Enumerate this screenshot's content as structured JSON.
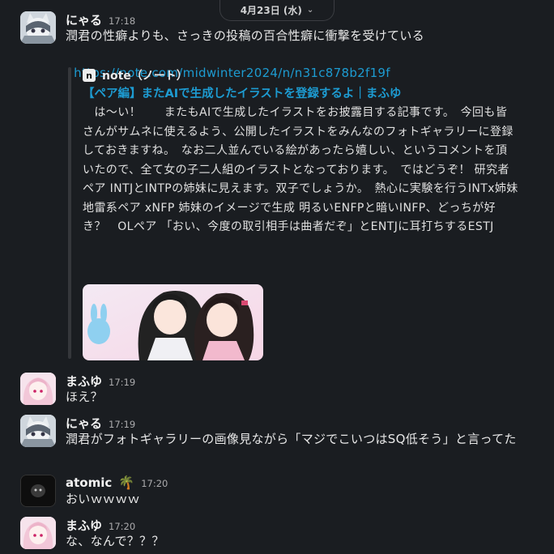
{
  "date_divider": {
    "label": "4月23日 (水)"
  },
  "messages": [
    {
      "author": "にゃる",
      "time": "17:18",
      "text": "潤君の性癖よりも、さっきの投稿の百合性癖に衝撃を受けている",
      "link": "https://note.com/midwinter2024/n/n31c878b2f19f",
      "unfurl": {
        "source_icon": "n",
        "source": "note（ノート）",
        "title": "【ペア編】またAIで生成したイラストを登録するよ｜まふゆ",
        "body": "　は〜い！　　またもAIで生成したイラストをお披露目する記事です。　今回も皆さんがサムネに使えるよう、公開したイラストをみんなのフォトギャラリーに登録しておきますね。　なお二人並んでいる絵があったら嬉しい、というコメントを頂いたので、全て女の子二人組のイラストとなっております。　ではどうぞ！ 研究者ペア INTJとINTPの姉妹に見えます。双子でしょうか。　熱心に実験を行うINTx姉妹　地雷系ペア xNFP 姉妹のイメージで生成 明るいENFPと暗いINFP、どっちが好き？　OLペア 「おい、今度の取引相手は曲者だぞ」とENTJに耳打ちするESTJ"
      }
    },
    {
      "author": "まふゆ",
      "time": "17:19",
      "text": "ほえ？"
    },
    {
      "author": "にゃる",
      "time": "17:19",
      "text": "潤君がフォトギャラリーの画像見ながら「マジでこいつはSQ低そう」と言ってた"
    },
    {
      "author": "atomic",
      "author_emoji": "🌴",
      "time": "17:20",
      "text": "おいｗｗｗｗ"
    },
    {
      "author": "まふゆ",
      "time": "17:20",
      "text": "な、なんで？？？"
    }
  ],
  "colors": {
    "background": "#1a1d21",
    "link": "#1d9bd1",
    "muted": "#ababad"
  },
  "icons": {
    "date_chevron": "chevron-down-icon"
  }
}
